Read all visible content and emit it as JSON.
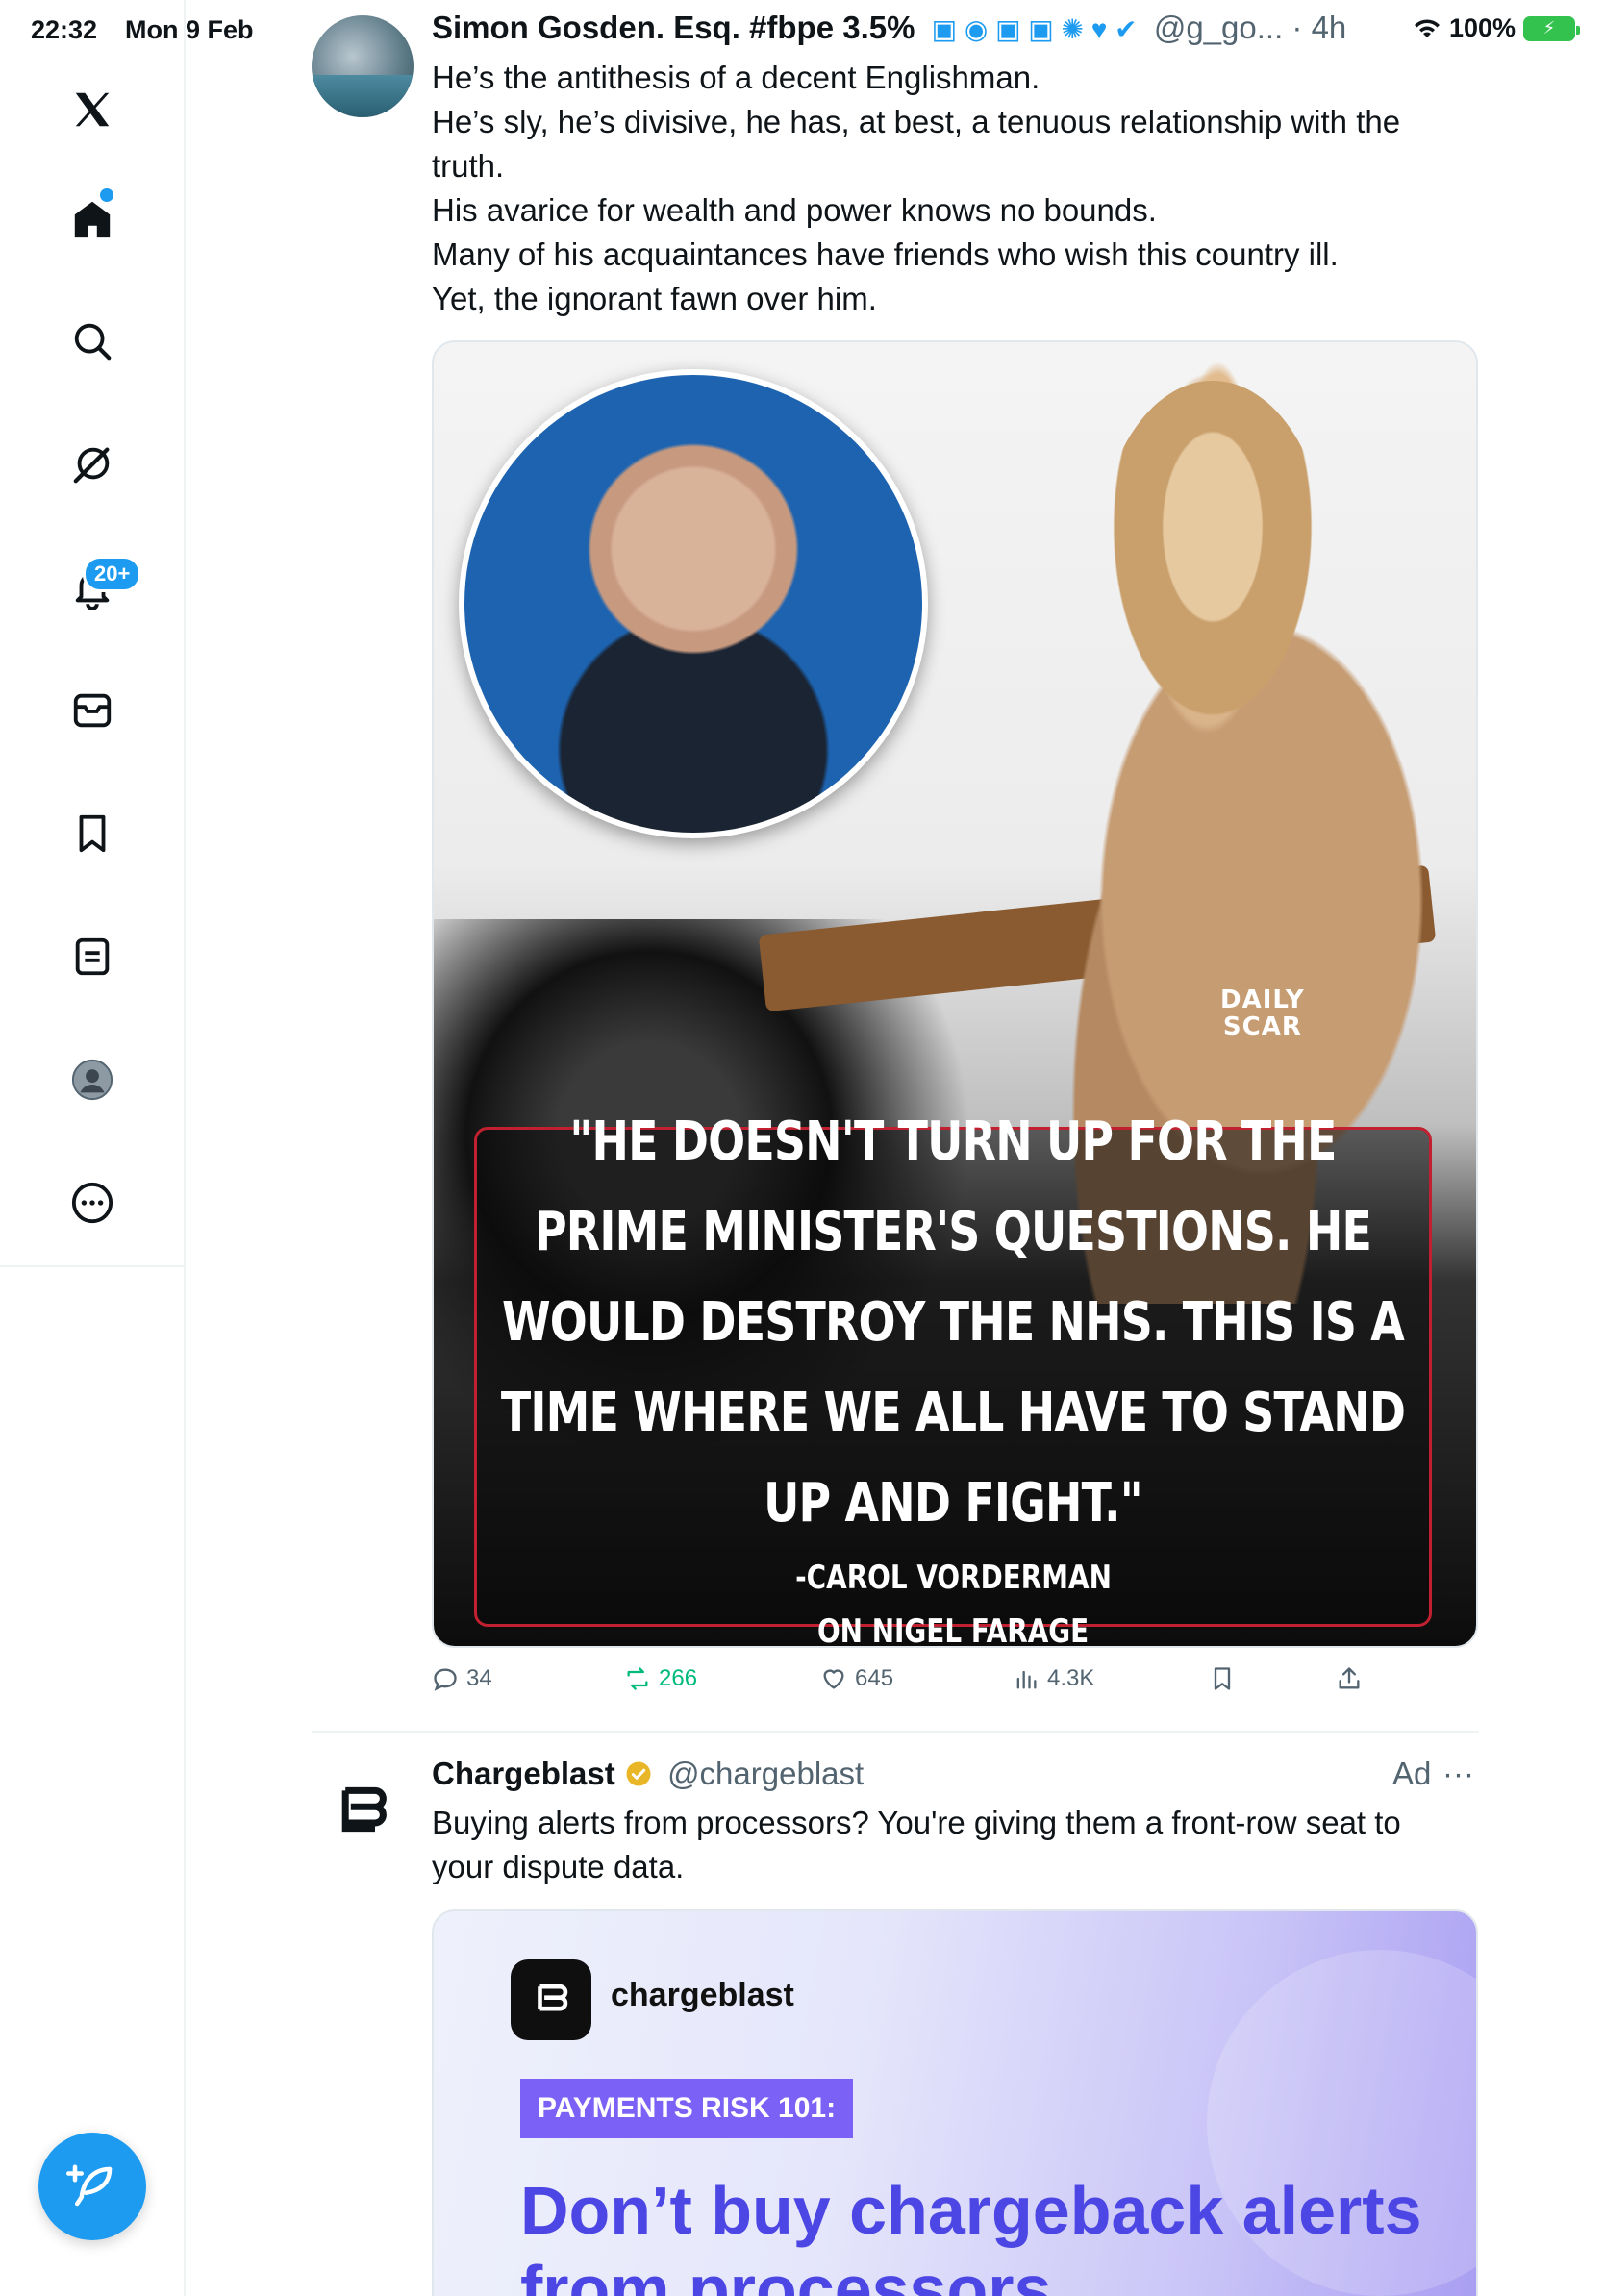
{
  "status_bar": {
    "time": "22:32",
    "date": "Mon 9 Feb",
    "battery": "100%"
  },
  "sidebar": {
    "notifications_badge": "20+"
  },
  "tweet": {
    "name": "Simon Gosden. Esq. #fbpe 3.5%",
    "handle": "@g_go...",
    "time_ago": "· 4h",
    "lines": [
      "He’s the antithesis of a decent Englishman.",
      "He’s sly, he’s divisive, he has, at best, a tenuous relationship with the truth.",
      "His avarice for wealth and power knows no bounds.",
      "Many of his acquaintances have friends who wish this country ill.",
      "Yet, the ignorant fawn over him."
    ],
    "media": {
      "logo_line1": "DAILY",
      "logo_line2": "SCAR",
      "quote": "\"HE DOESN'T TURN UP FOR THE PRIME MINISTER'S QUESTIONS. HE WOULD DESTROY THE NHS. THIS IS A TIME WHERE WE ALL HAVE TO STAND UP AND FIGHT.\"",
      "attribution_line1": "-CAROL VORDERMAN",
      "attribution_line2": "ON NIGEL FARAGE"
    },
    "stats": {
      "replies": "34",
      "reposts": "266",
      "likes": "645",
      "views": "4.3K"
    }
  },
  "ad": {
    "name": "Chargeblast",
    "handle": "@chargeblast",
    "label": "Ad",
    "more": "···",
    "body": "Buying alerts from processors? You're giving them a front-row seat to your dispute data.",
    "media": {
      "brand": "chargeblast",
      "pill": "PAYMENTS RISK 101:",
      "headline": "Don’t buy chargeback alerts from processors"
    }
  },
  "colors": {
    "accent": "#1d9bf0",
    "repost": "#00ba7c",
    "ad_purple": "#7b61f5",
    "ad_headline": "#4c46e4"
  }
}
